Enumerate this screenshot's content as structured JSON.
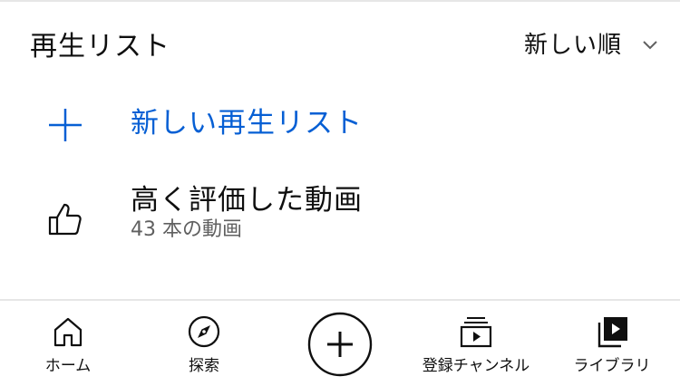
{
  "section": {
    "title": "再生リスト",
    "sort": {
      "label": "新しい順",
      "icon": "chevron-down-icon"
    }
  },
  "new_playlist": {
    "label": "新しい再生リスト",
    "icon": "plus-icon",
    "accent_color": "#065fd4"
  },
  "liked_videos": {
    "title": "高く評価した動画",
    "count": "43 本の動画",
    "icon": "thumbs-up-icon"
  },
  "bottom_nav": {
    "items": [
      {
        "label": "ホーム",
        "icon": "home-icon"
      },
      {
        "label": "探索",
        "icon": "compass-icon"
      },
      {
        "label": "",
        "icon": "create-plus-icon"
      },
      {
        "label": "登録チャンネル",
        "icon": "subscriptions-icon"
      },
      {
        "label": "ライブラリ",
        "icon": "library-icon"
      }
    ]
  }
}
